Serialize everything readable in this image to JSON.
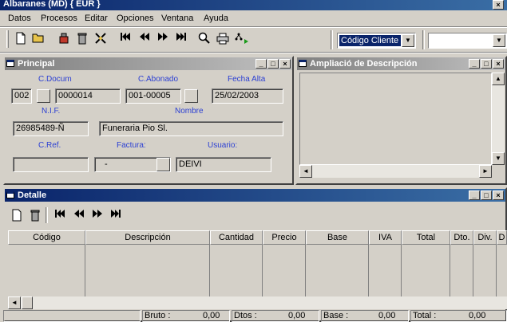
{
  "window": {
    "title": "Albaranes (MD) { EUR }"
  },
  "menu": [
    "Datos",
    "Procesos",
    "Editar",
    "Opciones",
    "Ventana",
    "Ayuda"
  ],
  "toolbar": {
    "combo_value": "Código Cliente",
    "combo2_value": ""
  },
  "principal": {
    "title": "Principal",
    "labels": {
      "cdocum": "C.Docum",
      "cabonado": "C.Abonado",
      "fecha_alta": "Fecha Alta",
      "nif": "N.I.F.",
      "nombre": "Nombre",
      "cref": "C.Ref.",
      "factura": "Factura:",
      "usuario": "Usuario:"
    },
    "values": {
      "cdocum_serie": "002",
      "cdocum_num": "0000014",
      "cabonado": "001-00005",
      "fecha_alta": "25/02/2003",
      "nif": "26985489-Ñ",
      "nombre": "Funeraria Pio Sl.",
      "cref": "",
      "factura": "-",
      "usuario": "DEIVI"
    }
  },
  "ampliacion": {
    "title": "Ampliació de Descripción"
  },
  "detalle": {
    "title": "Detalle",
    "columns": [
      "Código",
      "Descripción",
      "Cantidad",
      "Precio",
      "Base",
      "IVA",
      "Total",
      "Dto.",
      "Div.",
      "D"
    ]
  },
  "status": {
    "bruto_label": "Bruto :",
    "bruto": "0,00",
    "dtos_label": "Dtos :",
    "dtos": "0,00",
    "base_label": "Base :",
    "base": "0,00",
    "total_label": "Total :",
    "total": "0,00"
  }
}
